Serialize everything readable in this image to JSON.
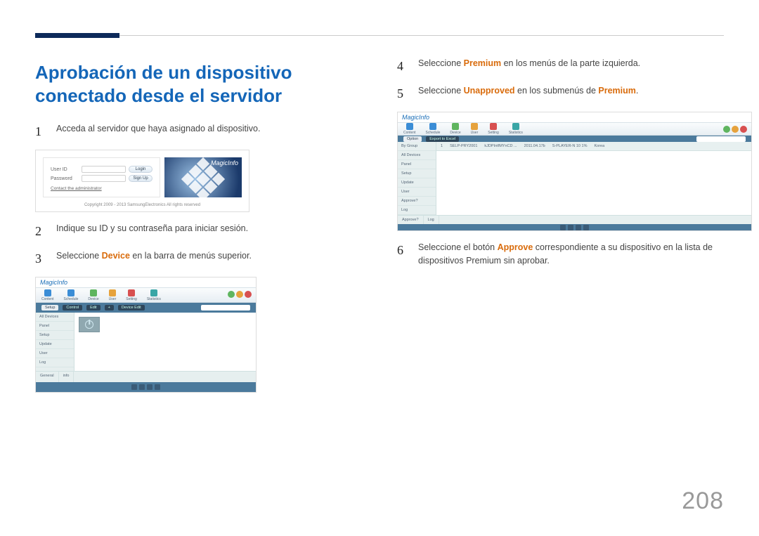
{
  "page_number": "208",
  "title": "Aprobación de un dispositivo conectado desde el servidor",
  "steps": {
    "s1": {
      "num": "1",
      "text": "Acceda al servidor que haya asignado al dispositivo."
    },
    "s2": {
      "num": "2",
      "text": "Indique su ID y su contraseña para iniciar sesión."
    },
    "s3": {
      "num": "3",
      "pre": "Seleccione ",
      "kw": "Device",
      "post": " en la barra de menús superior."
    },
    "s4": {
      "num": "4",
      "pre": "Seleccione ",
      "kw": "Premium",
      "post": " en los menús de la parte izquierda."
    },
    "s5": {
      "num": "5",
      "pre": "Seleccione ",
      "kw": "Unapproved",
      "post": " en los submenús de ",
      "kw2": "Premium",
      "post2": "."
    },
    "s6": {
      "num": "6",
      "pre": "Seleccione el botón ",
      "kw": "Approve",
      "post": " correspondiente a su dispositivo en la lista de dispositivos Premium sin aprobar."
    }
  },
  "login": {
    "brand": "MagicInfo",
    "user_label": "User ID",
    "pass_label": "Password",
    "login_btn": "Login",
    "signup_btn": "Sign Up",
    "admin_link": "Contact the administrator",
    "copyright": "Copyright 2009 - 2013 SamsungElectronics All rights reserved"
  },
  "app": {
    "logo": "MagicInfo",
    "toolbar": [
      "Content",
      "Schedule",
      "Device",
      "User",
      "Setting",
      "Statistics"
    ],
    "sidebar_a": [
      "All Devices",
      "Panel",
      "Setup",
      "Update",
      "User",
      "Log"
    ],
    "sidebar_b": [
      "By Group",
      "All Devices",
      "Panel",
      "Setup",
      "Update",
      "User",
      "Approve?",
      "Log"
    ],
    "sub_a": [
      "Setup",
      "Control",
      "Edit",
      "+",
      "Device Edit"
    ],
    "sub_b": [
      "Option",
      "Export to Excel"
    ],
    "row_b": [
      "1",
      "SELP-PRY2001",
      "kJDPIntfMYnCD ...",
      "2011.04.17b",
      "S-PLAYER-N 10 1%",
      "Korea"
    ]
  }
}
